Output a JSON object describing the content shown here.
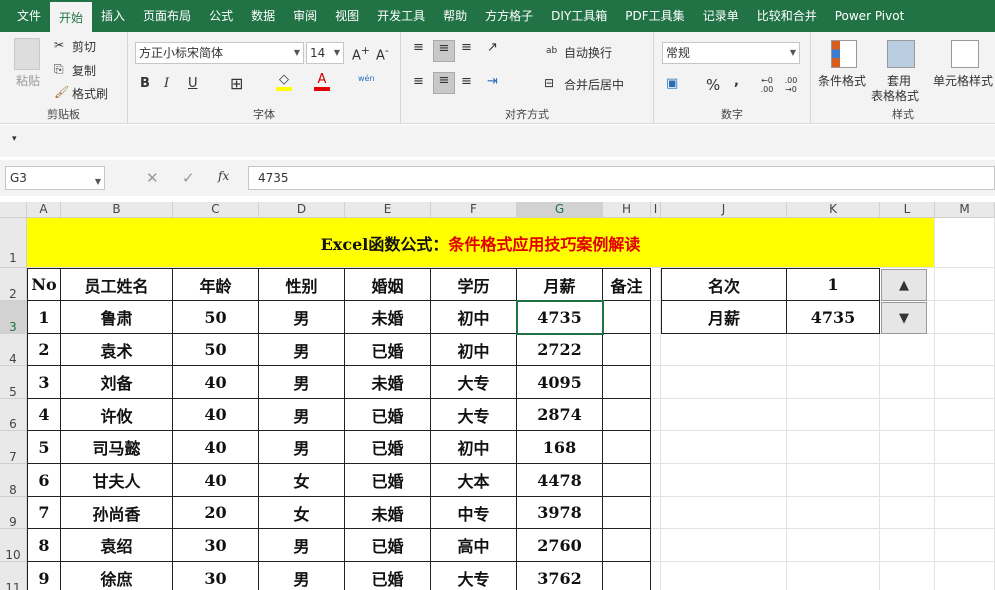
{
  "tabs": [
    "文件",
    "开始",
    "插入",
    "页面布局",
    "公式",
    "数据",
    "审阅",
    "视图",
    "开发工具",
    "帮助",
    "方方格子",
    "DIY工具箱",
    "PDF工具集",
    "记录单",
    "比较和合并",
    "Power Pivot"
  ],
  "active_tab": 1,
  "ribbon": {
    "clipboard": {
      "paste": "粘贴",
      "cut": "剪切",
      "copy": "复制",
      "format_painter": "格式刷",
      "label": "剪贴板"
    },
    "font": {
      "name": "方正小标宋简体",
      "size": "14",
      "bold": "B",
      "italic": "I",
      "underline": "U",
      "phonetic": "wén",
      "label": "字体",
      "fill_color": "#ffff00",
      "font_color": "#e00000"
    },
    "alignment": {
      "wrap": "自动换行",
      "merge": "合并后居中",
      "label": "对齐方式"
    },
    "number": {
      "format": "常规",
      "percent": "%",
      "comma": ",",
      "inc": "←0 .00",
      "dec": ".00 →0",
      "label": "数字"
    },
    "styles": {
      "conditional": "条件格式",
      "table": "套用",
      "table2": "表格格式",
      "cell": "单元格样式",
      "label": "样式"
    }
  },
  "formula_bar": {
    "name_box": "G3",
    "value": "4735",
    "fx": "fx"
  },
  "columns": [
    "A",
    "B",
    "C",
    "D",
    "E",
    "F",
    "G",
    "H",
    "I",
    "J",
    "K",
    "L",
    "M"
  ],
  "rows": [
    "1",
    "2",
    "3",
    "4",
    "5",
    "6",
    "7",
    "8",
    "9",
    "10",
    "11"
  ],
  "title": {
    "black": "Excel函数公式：",
    "red": "条件格式应用技巧案例解读"
  },
  "headers": [
    "No",
    "员工姓名",
    "年龄",
    "性别",
    "婚姻",
    "学历",
    "月薪",
    "备注"
  ],
  "data": [
    [
      "1",
      "鲁肃",
      "50",
      "男",
      "未婚",
      "初中",
      "4735",
      ""
    ],
    [
      "2",
      "袁术",
      "50",
      "男",
      "已婚",
      "初中",
      "2722",
      ""
    ],
    [
      "3",
      "刘备",
      "40",
      "男",
      "未婚",
      "大专",
      "4095",
      ""
    ],
    [
      "4",
      "许攸",
      "40",
      "男",
      "已婚",
      "大专",
      "2874",
      ""
    ],
    [
      "5",
      "司马懿",
      "40",
      "男",
      "已婚",
      "初中",
      "168",
      ""
    ],
    [
      "6",
      "甘夫人",
      "40",
      "女",
      "已婚",
      "大本",
      "4478",
      ""
    ],
    [
      "7",
      "孙尚香",
      "20",
      "女",
      "未婚",
      "中专",
      "3978",
      ""
    ],
    [
      "8",
      "袁绍",
      "30",
      "男",
      "已婚",
      "高中",
      "2760",
      ""
    ],
    [
      "9",
      "徐庶",
      "30",
      "男",
      "已婚",
      "大专",
      "3762",
      ""
    ]
  ],
  "side": {
    "rank_label": "名次",
    "rank_value": "1",
    "salary_label": "月薪",
    "salary_value": "4735"
  }
}
